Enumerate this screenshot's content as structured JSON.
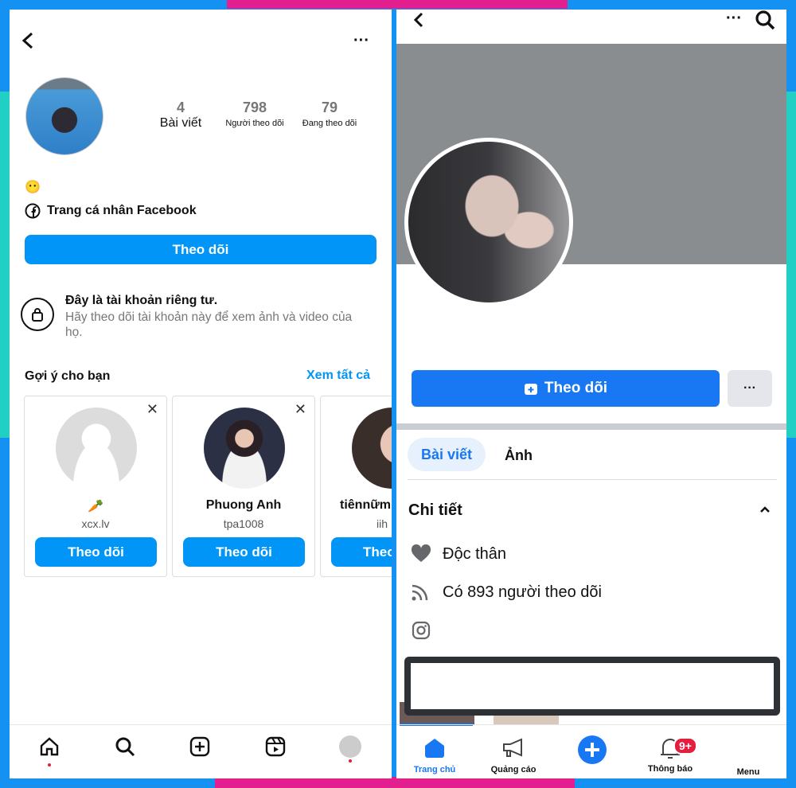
{
  "instagram": {
    "stats": [
      {
        "value": "4",
        "label": "Bài viết"
      },
      {
        "value": "798",
        "label": "Người theo dõi"
      },
      {
        "value": "79",
        "label": "Đang theo dõi"
      }
    ],
    "bio_emoji": "😶",
    "facebook_link": "Trang cá nhân Facebook",
    "follow_label": "Theo dõi",
    "private_title": "Đây là tài khoản riêng tư.",
    "private_desc": "Hãy theo dõi tài khoản này để xem ảnh và video của họ.",
    "suggest_title": "Gợi ý cho bạn",
    "see_all": "Xem tất cả",
    "suggestions": [
      {
        "name": "🥕",
        "username": "xcx.lv",
        "button": "Theo dõi"
      },
      {
        "name": "Phuong Anh",
        "username": "tpa1008",
        "button": "Theo dõi"
      },
      {
        "name": "tiênnữm",
        "username": "iih",
        "button": "Theo"
      }
    ],
    "nav": [
      "home-icon",
      "search-icon",
      "create-icon",
      "reels-icon",
      "profile-icon"
    ]
  },
  "facebook": {
    "follow_label": "Theo dõi",
    "more_label": "···",
    "tabs": [
      "Bài viết",
      "Ảnh"
    ],
    "details_title": "Chi tiết",
    "details": [
      "Độc thân",
      "Có 893 người theo dõi"
    ],
    "nav": [
      {
        "label": "Trang chủ",
        "icon": "home-icon"
      },
      {
        "label": "Quảng cáo",
        "icon": "megaphone-icon"
      },
      {
        "label": "",
        "icon": "plus-icon"
      },
      {
        "label": "Thông báo",
        "icon": "bell-icon",
        "badge": "9+"
      },
      {
        "label": "Menu",
        "icon": "menu-icon"
      }
    ]
  },
  "colors": {
    "ig_blue": "#0095f6",
    "fb_blue": "#1877f2",
    "badge_red": "#e41e3f"
  }
}
